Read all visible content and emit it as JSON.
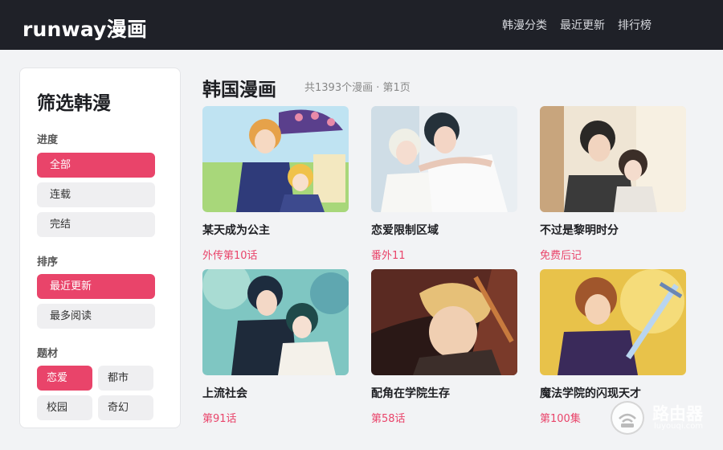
{
  "header": {
    "logo": "runway漫画",
    "nav": [
      "韩漫分类",
      "最近更新",
      "排行榜"
    ]
  },
  "sidebar": {
    "title": "筛选韩漫",
    "progress": {
      "label": "进度",
      "options": [
        "全部",
        "连载",
        "完结"
      ],
      "selected": "全部"
    },
    "sort": {
      "label": "排序",
      "options": [
        "最近更新",
        "最多阅读"
      ],
      "selected": "最近更新"
    },
    "genre": {
      "label": "题材",
      "options": [
        "恋爱",
        "都市",
        "校园",
        "奇幻"
      ],
      "selected": "恋爱"
    }
  },
  "main": {
    "title": "韩国漫画",
    "subtitle": "共1393个漫画 · 第1页",
    "cards": [
      {
        "title": "某天成为公主",
        "episode": "外传第10话"
      },
      {
        "title": "恋爱限制区域",
        "episode": "番外11"
      },
      {
        "title": "不过是黎明时分",
        "episode": "免费后记"
      },
      {
        "title": "上流社会",
        "episode": "第91话"
      },
      {
        "title": "配角在学院生存",
        "episode": "第58话"
      },
      {
        "title": "魔法学院的闪现天才",
        "episode": "第100集"
      }
    ]
  },
  "watermark": {
    "text": "路由器",
    "sub": "luyouqi.com"
  },
  "colors": {
    "accent": "#e9446a",
    "topbar": "#1f2128"
  }
}
